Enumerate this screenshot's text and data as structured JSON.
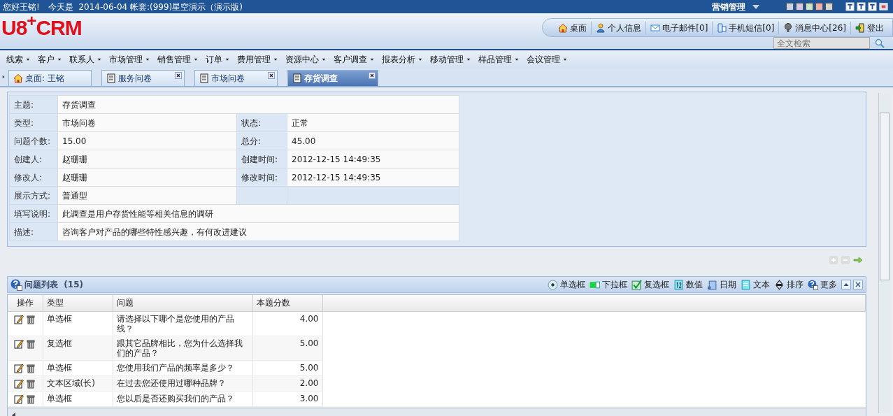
{
  "top_bar": {
    "greeting": "您好王铭!",
    "date_text": "今天是  2014-06-04 帐套:(999)星空演示（演示版)",
    "module": "营销管理"
  },
  "header": {
    "logo": "U8$^{+}$CRM",
    "links": [
      {
        "kind": "home",
        "label": "桌面"
      },
      {
        "kind": "user",
        "label": "个人信息"
      },
      {
        "kind": "mail",
        "label": "电子邮件[0]"
      },
      {
        "kind": "phone",
        "label": "手机短信[0]"
      },
      {
        "kind": "message",
        "label": "消息中心[26]"
      },
      {
        "kind": "logout",
        "label": "登出"
      }
    ],
    "search": {
      "placeholder": "全文检索"
    }
  },
  "menu": [
    "线索",
    "客户",
    "联系人",
    "市场管理",
    "销售管理",
    "订单",
    "费用管理",
    "资源中心",
    "客户调查",
    "报表分析",
    "移动管理",
    "样品管理",
    "会议管理"
  ],
  "tabs": [
    {
      "kind": "home",
      "label": "桌面: 王铭",
      "closable": false,
      "selected": false
    },
    {
      "kind": "doc",
      "label": "服务问卷",
      "closable": true,
      "selected": false
    },
    {
      "kind": "doc",
      "label": "市场问卷",
      "closable": true,
      "selected": false
    },
    {
      "kind": "doc",
      "label": "存货调查",
      "closable": true,
      "selected": true
    }
  ],
  "details": [
    {
      "wide": true,
      "cells": [
        {
          "label": "主题:",
          "value": "存货调查"
        }
      ]
    },
    {
      "wide": false,
      "cells": [
        {
          "label": "类型:",
          "value": "市场问卷"
        },
        {
          "label": "状态:",
          "value": "正常"
        }
      ]
    },
    {
      "wide": false,
      "cells": [
        {
          "label": "问题个数:",
          "value": "15.00"
        },
        {
          "label": "总分:",
          "value": "45.00"
        }
      ]
    },
    {
      "wide": false,
      "cells": [
        {
          "label": "创建人:",
          "value": "赵珊珊"
        },
        {
          "label": "创建时间:",
          "value": "2012-12-15 14:49:35"
        }
      ]
    },
    {
      "wide": false,
      "cells": [
        {
          "label": "修改人:",
          "value": "赵珊珊"
        },
        {
          "label": "修改时间:",
          "value": "2012-12-15 14:49:35"
        }
      ]
    },
    {
      "wide": false,
      "cells": [
        {
          "label": "展示方式:",
          "value": "普通型"
        }
      ]
    },
    {
      "wide": true,
      "cells": [
        {
          "label": "填写说明:",
          "value": "此调查是用户存货性能等相关信息的调研"
        }
      ]
    },
    {
      "wide": true,
      "cells": [
        {
          "label": "描述:",
          "value": "咨询客户对产品的哪些特性感兴趣，有何改进建议"
        }
      ]
    }
  ],
  "question_list": {
    "title": "问题列表",
    "count": "(15)",
    "tools": [
      {
        "kind": "radio",
        "label": "单选框"
      },
      {
        "kind": "dropdown",
        "label": "下拉框"
      },
      {
        "kind": "checkbox",
        "label": "复选框"
      },
      {
        "kind": "number",
        "label": "数值"
      },
      {
        "kind": "date",
        "label": "日期"
      },
      {
        "kind": "text",
        "label": "文本"
      },
      {
        "kind": "sort",
        "label": "排序"
      },
      {
        "kind": "more",
        "label": "更多"
      }
    ],
    "columns": [
      "操作",
      "类型",
      "问题",
      "本题分数"
    ],
    "rows": [
      {
        "type": "单选框",
        "question": "请选择以下哪个是您使用的产品线？",
        "score": "4.00"
      },
      {
        "type": "复选框",
        "question": "跟其它品牌相比，您为什么选择我们的产品？",
        "score": "5.00"
      },
      {
        "type": "单选框",
        "question": "您使用我们产品的频率是多少？",
        "score": "5.00"
      },
      {
        "type": "文本区域(长)",
        "question": "在过去您还使用过哪种品牌？",
        "score": "2.00"
      },
      {
        "type": "单选框",
        "question": "您以后是否还购买我们的产品？",
        "score": "3.00"
      }
    ]
  }
}
